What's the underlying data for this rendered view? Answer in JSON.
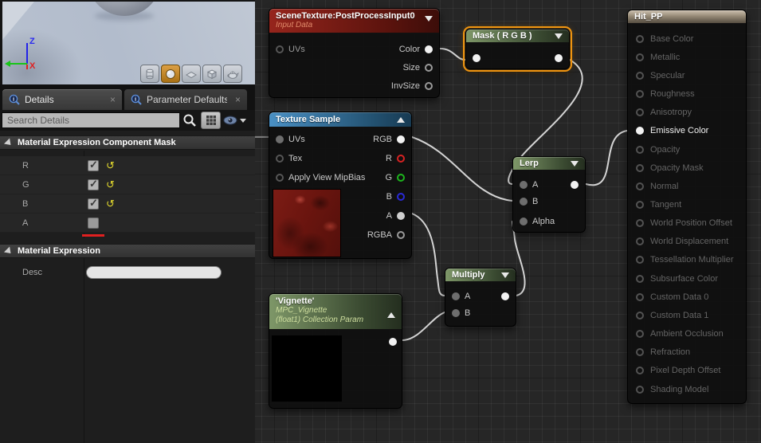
{
  "colors": {
    "selection_orange": "#ef9410",
    "wire": "#d4d4d4",
    "pin_red": "#d82222",
    "pin_green": "#1db51d",
    "pin_blue": "#2a2ad8",
    "header_scene_texture": "#96251c",
    "header_texture_sample": "#4a90c4",
    "header_math_green": "#7e9768",
    "header_result_tan": "#cdc1b0",
    "reset_yellow": "#e3d92e",
    "red_bar": "#e02020"
  },
  "viewport": {
    "axis_z": "Z",
    "axis_x": "X",
    "shape_buttons": [
      "cylinder",
      "sphere",
      "plane",
      "cube",
      "teapot"
    ],
    "selected_shape": "sphere"
  },
  "tabs": {
    "details": "Details",
    "parameter_defaults": "Parameter Defaults",
    "close_glyph": "×"
  },
  "details_panel": {
    "search_placeholder": "Search Details",
    "section_component_mask": "Material Expression Component Mask",
    "rows": [
      {
        "label": "R",
        "checked": true,
        "reset": true
      },
      {
        "label": "G",
        "checked": true,
        "reset": true
      },
      {
        "label": "B",
        "checked": true,
        "reset": true
      },
      {
        "label": "A",
        "checked": false,
        "reset": false
      }
    ],
    "section_material_expression": "Material Expression",
    "desc_label": "Desc",
    "desc_value": ""
  },
  "graph": {
    "scene_texture": {
      "title": "SceneTexture:PostProcessInput0",
      "subtitle": "Input Data",
      "in_uvs": "UVs",
      "out_color": "Color",
      "out_size": "Size",
      "out_invsize": "InvSize"
    },
    "mask": {
      "title": "Mask ( R G B )"
    },
    "texture_sample": {
      "title": "Texture Sample",
      "in_uvs": "UVs",
      "in_tex": "Tex",
      "in_mipbias": "Apply View MipBias",
      "out_rgb": "RGB",
      "out_r": "R",
      "out_g": "G",
      "out_b": "B",
      "out_a": "A",
      "out_rgba": "RGBA"
    },
    "lerp": {
      "title": "Lerp",
      "in_a": "A",
      "in_b": "B",
      "in_alpha": "Alpha"
    },
    "multiply": {
      "title": "Multiply",
      "in_a": "A",
      "in_b": "B"
    },
    "vignette": {
      "title": "'Vignette'",
      "subtitle1": "MPC_Vignette",
      "subtitle2": "(float1) Collection Param"
    },
    "hit_pp": {
      "title": "Hit_PP",
      "active_pin": "Emissive Color",
      "pins": [
        "Base Color",
        "Metallic",
        "Specular",
        "Roughness",
        "Anisotropy",
        "Emissive Color",
        "Opacity",
        "Opacity Mask",
        "Normal",
        "Tangent",
        "World Position Offset",
        "World Displacement",
        "Tessellation Multiplier",
        "Subsurface Color",
        "Custom Data 0",
        "Custom Data 1",
        "Ambient Occlusion",
        "Refraction",
        "Pixel Depth Offset",
        "Shading Model"
      ]
    }
  }
}
